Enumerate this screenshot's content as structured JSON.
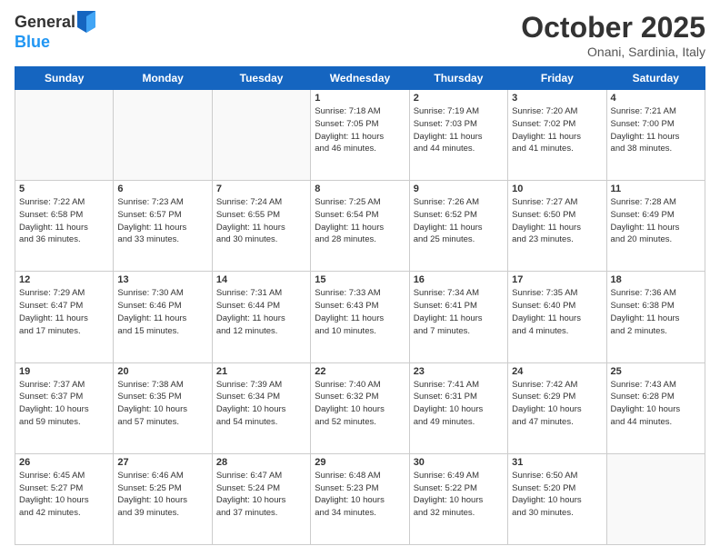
{
  "header": {
    "logo_line1": "General",
    "logo_line2": "Blue",
    "month": "October 2025",
    "location": "Onani, Sardinia, Italy"
  },
  "weekdays": [
    "Sunday",
    "Monday",
    "Tuesday",
    "Wednesday",
    "Thursday",
    "Friday",
    "Saturday"
  ],
  "weeks": [
    [
      {
        "day": "",
        "info": ""
      },
      {
        "day": "",
        "info": ""
      },
      {
        "day": "",
        "info": ""
      },
      {
        "day": "1",
        "info": "Sunrise: 7:18 AM\nSunset: 7:05 PM\nDaylight: 11 hours\nand 46 minutes."
      },
      {
        "day": "2",
        "info": "Sunrise: 7:19 AM\nSunset: 7:03 PM\nDaylight: 11 hours\nand 44 minutes."
      },
      {
        "day": "3",
        "info": "Sunrise: 7:20 AM\nSunset: 7:02 PM\nDaylight: 11 hours\nand 41 minutes."
      },
      {
        "day": "4",
        "info": "Sunrise: 7:21 AM\nSunset: 7:00 PM\nDaylight: 11 hours\nand 38 minutes."
      }
    ],
    [
      {
        "day": "5",
        "info": "Sunrise: 7:22 AM\nSunset: 6:58 PM\nDaylight: 11 hours\nand 36 minutes."
      },
      {
        "day": "6",
        "info": "Sunrise: 7:23 AM\nSunset: 6:57 PM\nDaylight: 11 hours\nand 33 minutes."
      },
      {
        "day": "7",
        "info": "Sunrise: 7:24 AM\nSunset: 6:55 PM\nDaylight: 11 hours\nand 30 minutes."
      },
      {
        "day": "8",
        "info": "Sunrise: 7:25 AM\nSunset: 6:54 PM\nDaylight: 11 hours\nand 28 minutes."
      },
      {
        "day": "9",
        "info": "Sunrise: 7:26 AM\nSunset: 6:52 PM\nDaylight: 11 hours\nand 25 minutes."
      },
      {
        "day": "10",
        "info": "Sunrise: 7:27 AM\nSunset: 6:50 PM\nDaylight: 11 hours\nand 23 minutes."
      },
      {
        "day": "11",
        "info": "Sunrise: 7:28 AM\nSunset: 6:49 PM\nDaylight: 11 hours\nand 20 minutes."
      }
    ],
    [
      {
        "day": "12",
        "info": "Sunrise: 7:29 AM\nSunset: 6:47 PM\nDaylight: 11 hours\nand 17 minutes."
      },
      {
        "day": "13",
        "info": "Sunrise: 7:30 AM\nSunset: 6:46 PM\nDaylight: 11 hours\nand 15 minutes."
      },
      {
        "day": "14",
        "info": "Sunrise: 7:31 AM\nSunset: 6:44 PM\nDaylight: 11 hours\nand 12 minutes."
      },
      {
        "day": "15",
        "info": "Sunrise: 7:33 AM\nSunset: 6:43 PM\nDaylight: 11 hours\nand 10 minutes."
      },
      {
        "day": "16",
        "info": "Sunrise: 7:34 AM\nSunset: 6:41 PM\nDaylight: 11 hours\nand 7 minutes."
      },
      {
        "day": "17",
        "info": "Sunrise: 7:35 AM\nSunset: 6:40 PM\nDaylight: 11 hours\nand 4 minutes."
      },
      {
        "day": "18",
        "info": "Sunrise: 7:36 AM\nSunset: 6:38 PM\nDaylight: 11 hours\nand 2 minutes."
      }
    ],
    [
      {
        "day": "19",
        "info": "Sunrise: 7:37 AM\nSunset: 6:37 PM\nDaylight: 10 hours\nand 59 minutes."
      },
      {
        "day": "20",
        "info": "Sunrise: 7:38 AM\nSunset: 6:35 PM\nDaylight: 10 hours\nand 57 minutes."
      },
      {
        "day": "21",
        "info": "Sunrise: 7:39 AM\nSunset: 6:34 PM\nDaylight: 10 hours\nand 54 minutes."
      },
      {
        "day": "22",
        "info": "Sunrise: 7:40 AM\nSunset: 6:32 PM\nDaylight: 10 hours\nand 52 minutes."
      },
      {
        "day": "23",
        "info": "Sunrise: 7:41 AM\nSunset: 6:31 PM\nDaylight: 10 hours\nand 49 minutes."
      },
      {
        "day": "24",
        "info": "Sunrise: 7:42 AM\nSunset: 6:29 PM\nDaylight: 10 hours\nand 47 minutes."
      },
      {
        "day": "25",
        "info": "Sunrise: 7:43 AM\nSunset: 6:28 PM\nDaylight: 10 hours\nand 44 minutes."
      }
    ],
    [
      {
        "day": "26",
        "info": "Sunrise: 6:45 AM\nSunset: 5:27 PM\nDaylight: 10 hours\nand 42 minutes."
      },
      {
        "day": "27",
        "info": "Sunrise: 6:46 AM\nSunset: 5:25 PM\nDaylight: 10 hours\nand 39 minutes."
      },
      {
        "day": "28",
        "info": "Sunrise: 6:47 AM\nSunset: 5:24 PM\nDaylight: 10 hours\nand 37 minutes."
      },
      {
        "day": "29",
        "info": "Sunrise: 6:48 AM\nSunset: 5:23 PM\nDaylight: 10 hours\nand 34 minutes."
      },
      {
        "day": "30",
        "info": "Sunrise: 6:49 AM\nSunset: 5:22 PM\nDaylight: 10 hours\nand 32 minutes."
      },
      {
        "day": "31",
        "info": "Sunrise: 6:50 AM\nSunset: 5:20 PM\nDaylight: 10 hours\nand 30 minutes."
      },
      {
        "day": "",
        "info": ""
      }
    ]
  ]
}
